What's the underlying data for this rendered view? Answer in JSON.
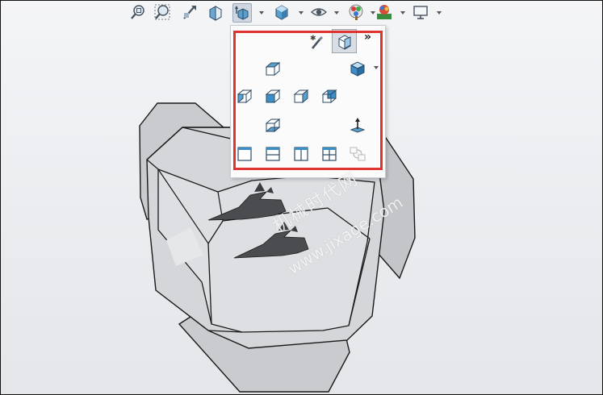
{
  "toolbar": {
    "buttons": [
      {
        "name": "zoom-to-fit",
        "icon": "zoom-to-fit-icon"
      },
      {
        "name": "zoom-to-area",
        "icon": "zoom-to-area-icon"
      },
      {
        "name": "previous-view",
        "icon": "previous-view-icon"
      },
      {
        "name": "section-view",
        "icon": "section-view-icon"
      },
      {
        "name": "view-orientation",
        "icon": "view-orientation-icon",
        "active": true
      },
      {
        "name": "display-style",
        "icon": "display-style-icon"
      },
      {
        "name": "hide-show-items",
        "icon": "eye-icon"
      },
      {
        "name": "edit-appearance",
        "icon": "appearance-icon"
      },
      {
        "name": "apply-scene",
        "icon": "scene-icon"
      },
      {
        "name": "view-settings",
        "icon": "monitor-icon"
      }
    ]
  },
  "flyout": {
    "more_label": "»",
    "icons": [
      "new-view-icon",
      "normal-to-icon",
      "top-view-icon",
      "isometric-view-icon",
      "left-view-icon",
      "front-view-icon",
      "right-view-icon",
      "back-view-icon",
      "bottom-view-icon",
      "view-selector-icon",
      "single-view-icon",
      "two-view-horizontal-icon",
      "two-view-vertical-icon",
      "four-view-icon",
      "link-views-icon"
    ]
  },
  "watermark": {
    "line1": "机械时代网",
    "line2": "www.jixage.com"
  },
  "colors": {
    "highlight": "#e0322f",
    "face_blue": "#2f8fc9",
    "model_fill": "#cfd2d6"
  }
}
